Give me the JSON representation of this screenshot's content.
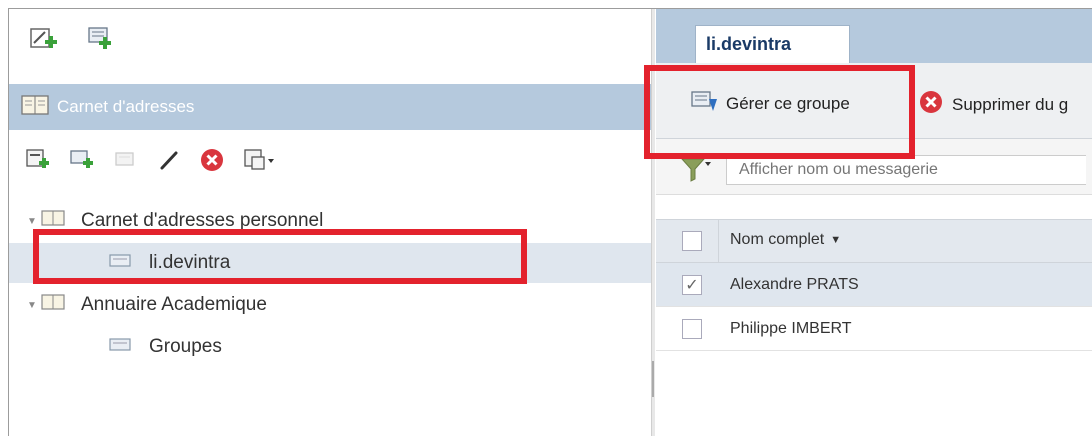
{
  "addressbook": {
    "title": "Carnet d'adresses"
  },
  "tree": {
    "items": [
      {
        "label": "Carnet d'adresses personnel",
        "expanded": true,
        "level": 0
      },
      {
        "label": "li.devintra",
        "level": 1,
        "selected": true
      },
      {
        "label": "Annuaire Academique",
        "expanded": true,
        "level": 0
      },
      {
        "label": "Groupes",
        "level": 1
      }
    ]
  },
  "right": {
    "tab_label": "li.devintra",
    "actions": {
      "manage_label": "Gérer ce groupe",
      "delete_label": "Supprimer du g"
    },
    "filter": {
      "placeholder": "Afficher nom ou messagerie"
    },
    "columns": {
      "name_header": "Nom complet"
    },
    "contacts": [
      {
        "name": "Alexandre PRATS",
        "checked": true
      },
      {
        "name": "Philippe IMBERT",
        "checked": false
      }
    ]
  },
  "colors": {
    "header_bg": "#b5c9dd",
    "highlight": "#e3222d",
    "selected_row": "#dfe6ee"
  }
}
